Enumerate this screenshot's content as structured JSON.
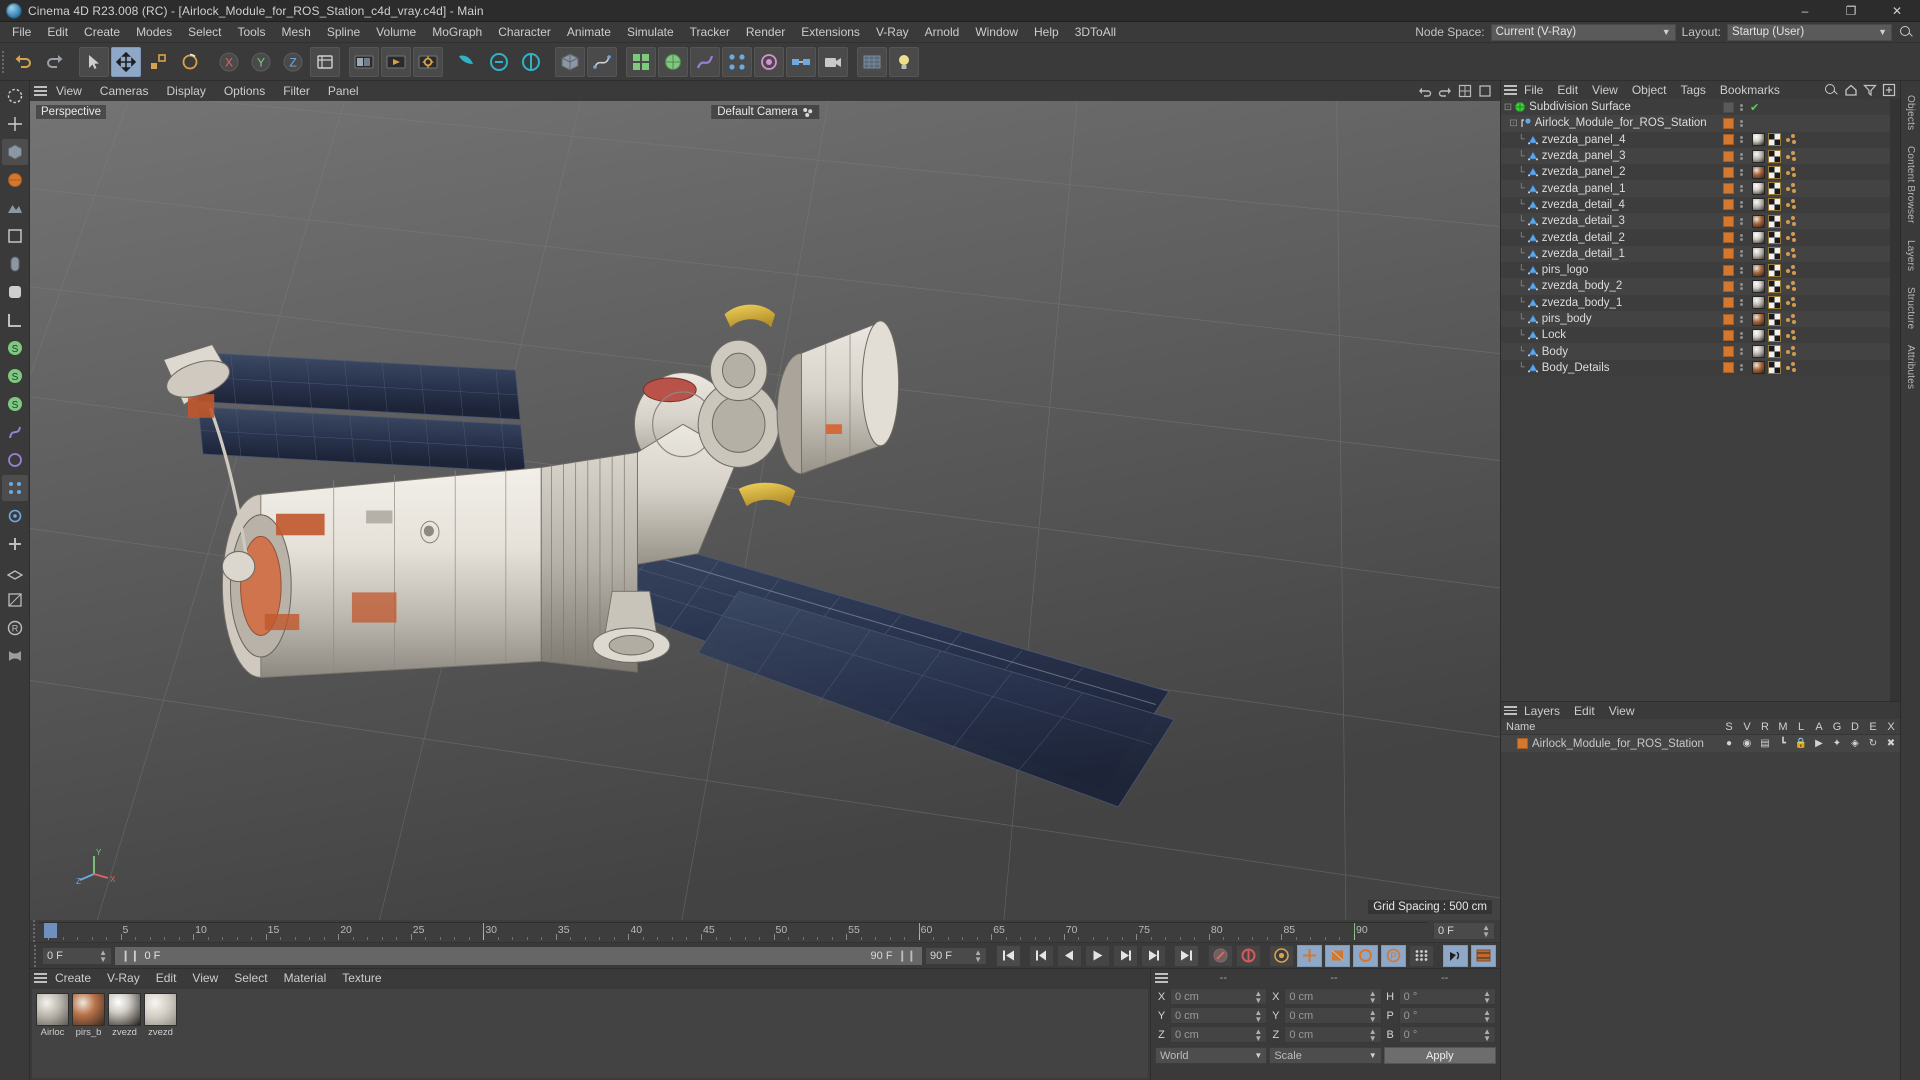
{
  "window": {
    "title": "Cinema 4D R23.008 (RC) - [Airlock_Module_for_ROS_Station_c4d_vray.c4d] - Main",
    "minimize": "–",
    "maximize": "❐",
    "close": "✕"
  },
  "menubar": {
    "items": [
      "File",
      "Edit",
      "Create",
      "Modes",
      "Select",
      "Tools",
      "Mesh",
      "Spline",
      "Volume",
      "MoGraph",
      "Character",
      "Animate",
      "Simulate",
      "Tracker",
      "Render",
      "Extensions",
      "V-Ray",
      "Arnold",
      "Window",
      "Help",
      "3DToAll"
    ],
    "node_space_label": "Node Space:",
    "node_space_value": "Current (V-Ray)",
    "layout_label": "Layout:",
    "layout_value": "Startup (User)",
    "search_icon": "search-icon"
  },
  "viewport": {
    "menu": [
      "View",
      "Cameras",
      "Display",
      "Options",
      "Filter",
      "Panel"
    ],
    "label": "Perspective",
    "camera": "Default Camera",
    "grid_spacing": "Grid Spacing : 500 cm",
    "axis": {
      "x": "X",
      "y": "Y",
      "z": "Z"
    }
  },
  "timeline": {
    "ticks": [
      {
        "label": "0",
        "pos": 0
      },
      {
        "label": "5",
        "pos": 5
      },
      {
        "label": "10",
        "pos": 10
      },
      {
        "label": "15",
        "pos": 15
      },
      {
        "label": "20",
        "pos": 20
      },
      {
        "label": "25",
        "pos": 25
      },
      {
        "label": "30",
        "pos": 30
      },
      {
        "label": "35",
        "pos": 35
      },
      {
        "label": "40",
        "pos": 40
      },
      {
        "label": "45",
        "pos": 45
      },
      {
        "label": "50",
        "pos": 50
      },
      {
        "label": "55",
        "pos": 55
      },
      {
        "label": "60",
        "pos": 60
      },
      {
        "label": "65",
        "pos": 65
      },
      {
        "label": "70",
        "pos": 70
      },
      {
        "label": "75",
        "pos": 75
      },
      {
        "label": "80",
        "pos": 80
      },
      {
        "label": "85",
        "pos": 85
      },
      {
        "label": "90",
        "pos": 90
      }
    ],
    "range_min": 0,
    "range_max": 90,
    "current_frame_field": "0 F",
    "current_frame_strip": "0 F",
    "end_frame_field": "0 F",
    "preview_end": "90 F",
    "doc_end": "90 F"
  },
  "materials": {
    "menu": [
      "Create",
      "V-Ray",
      "Edit",
      "View",
      "Select",
      "Material",
      "Texture"
    ],
    "items": [
      {
        "name": "Airloc"
      },
      {
        "name": "pirs_b"
      },
      {
        "name": "zvezd"
      },
      {
        "name": "zvezd"
      }
    ]
  },
  "coordinates": {
    "header": [
      "--",
      "--",
      "--"
    ],
    "rows": [
      {
        "pos_axis": "X",
        "pos_value": "0 cm",
        "size_axis": "X",
        "size_value": "0 cm",
        "rot_axis": "H",
        "rot_value": "0 °"
      },
      {
        "pos_axis": "Y",
        "pos_value": "0 cm",
        "size_axis": "Y",
        "size_value": "0 cm",
        "rot_axis": "P",
        "rot_value": "0 °"
      },
      {
        "pos_axis": "Z",
        "pos_value": "0 cm",
        "size_axis": "Z",
        "size_value": "0 cm",
        "rot_axis": "B",
        "rot_value": "0 °"
      }
    ],
    "world_select": "World",
    "scale_select": "Scale",
    "apply_label": "Apply"
  },
  "object_manager": {
    "menu": [
      "File",
      "Edit",
      "View",
      "Object",
      "Tags",
      "Bookmarks"
    ],
    "objects": [
      {
        "name": "Subdivision Surface",
        "depth": 0,
        "kind": "generator",
        "chip": false,
        "tags": []
      },
      {
        "name": "Airlock_Module_for_ROS_Station",
        "depth": 1,
        "kind": "null",
        "chip": true,
        "tags": []
      },
      {
        "name": "zvezda_panel_4",
        "depth": 2,
        "kind": "polygon",
        "chip": true,
        "tags": [
          "material",
          "uv",
          "dots"
        ]
      },
      {
        "name": "zvezda_panel_3",
        "depth": 2,
        "kind": "polygon",
        "chip": true,
        "tags": [
          "material",
          "uv",
          "dots"
        ]
      },
      {
        "name": "zvezda_panel_2",
        "depth": 2,
        "kind": "polygon",
        "chip": true,
        "tags": [
          "material",
          "uv",
          "dots"
        ]
      },
      {
        "name": "zvezda_panel_1",
        "depth": 2,
        "kind": "polygon",
        "chip": true,
        "tags": [
          "material",
          "uv",
          "dots"
        ]
      },
      {
        "name": "zvezda_detail_4",
        "depth": 2,
        "kind": "polygon",
        "chip": true,
        "tags": [
          "material",
          "uv",
          "dots"
        ]
      },
      {
        "name": "zvezda_detail_3",
        "depth": 2,
        "kind": "polygon",
        "chip": true,
        "tags": [
          "material",
          "uv",
          "dots"
        ]
      },
      {
        "name": "zvezda_detail_2",
        "depth": 2,
        "kind": "polygon",
        "chip": true,
        "tags": [
          "material",
          "uv",
          "dots"
        ]
      },
      {
        "name": "zvezda_detail_1",
        "depth": 2,
        "kind": "polygon",
        "chip": true,
        "tags": [
          "material",
          "uv",
          "dots"
        ]
      },
      {
        "name": "pirs_logo",
        "depth": 2,
        "kind": "polygon",
        "chip": true,
        "tags": [
          "material",
          "uv",
          "dots"
        ]
      },
      {
        "name": "zvezda_body_2",
        "depth": 2,
        "kind": "polygon",
        "chip": true,
        "tags": [
          "material",
          "uv",
          "dots"
        ]
      },
      {
        "name": "zvezda_body_1",
        "depth": 2,
        "kind": "polygon",
        "chip": true,
        "tags": [
          "material",
          "uv",
          "dots"
        ]
      },
      {
        "name": "pirs_body",
        "depth": 2,
        "kind": "polygon",
        "chip": true,
        "tags": [
          "material",
          "uv",
          "dots"
        ]
      },
      {
        "name": "Lock",
        "depth": 2,
        "kind": "polygon",
        "chip": true,
        "tags": [
          "material",
          "uv",
          "dots"
        ]
      },
      {
        "name": "Body",
        "depth": 2,
        "kind": "polygon",
        "chip": true,
        "tags": [
          "material",
          "uv",
          "dots"
        ]
      },
      {
        "name": "Body_Details",
        "depth": 2,
        "kind": "polygon",
        "chip": true,
        "tags": [
          "material",
          "uv",
          "dots"
        ]
      }
    ]
  },
  "layer_manager": {
    "menu": [
      "Layers",
      "Edit",
      "View"
    ],
    "columns": [
      "Name",
      "S",
      "V",
      "R",
      "M",
      "L",
      "A",
      "G",
      "D",
      "E",
      "X"
    ],
    "rows": [
      {
        "name": "Airlock_Module_for_ROS_Station",
        "color": "#d4782f"
      }
    ]
  },
  "right_rail_tabs": [
    "Objects",
    "Content Browser",
    "Layers",
    "Structure",
    "Attributes"
  ],
  "colors": {
    "accent_orange": "#d4782f",
    "accent_blue": "#8fa8c8",
    "panel_bg": "#3a3a3a",
    "field_bg": "#4a4a4a"
  }
}
